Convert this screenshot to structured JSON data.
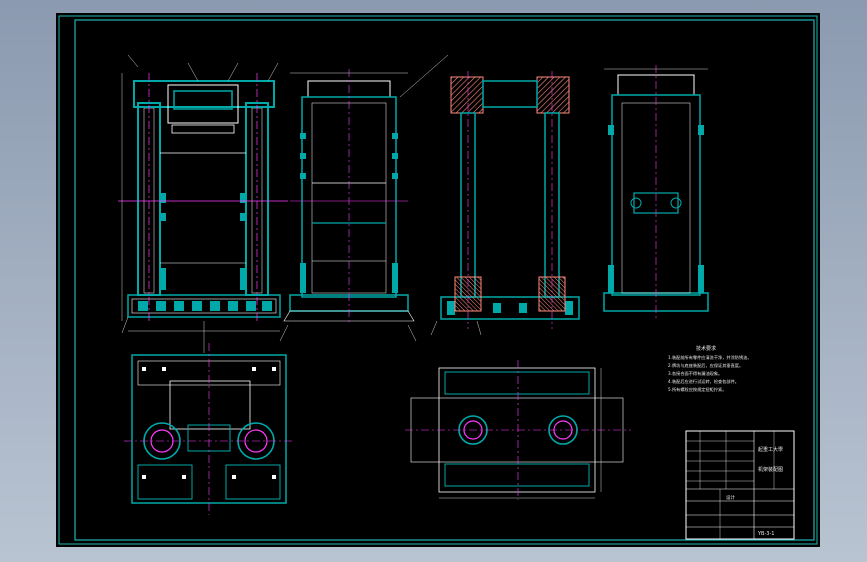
{
  "drawing": {
    "background": "#000000",
    "frame_color": "#1fb5b5",
    "line_color": "#ffffff",
    "steel_color": "#00a9a9",
    "hatch_color": "#ff8a7a",
    "center_color": "#ff3bff",
    "dim_color": "#cfcfcf",
    "hidden_color": "#3bd3d3"
  },
  "title_block": {
    "company": "起重工大學",
    "drawing_name": "机架装配图",
    "drawing_no": "YB-3-1",
    "designer": "设计"
  },
  "notes": {
    "heading": "技术要求",
    "lines": [
      "1.装配前所有零件应清洗干净，并涂防锈油。",
      "2.牌坊与底座装配后，应保证其垂直度。",
      "3.各接合面不得有漏油现象。",
      "4.装配后应进行试运转，检查各部件。",
      "5.所有螺栓应按规定扭矩拧紧。"
    ]
  }
}
